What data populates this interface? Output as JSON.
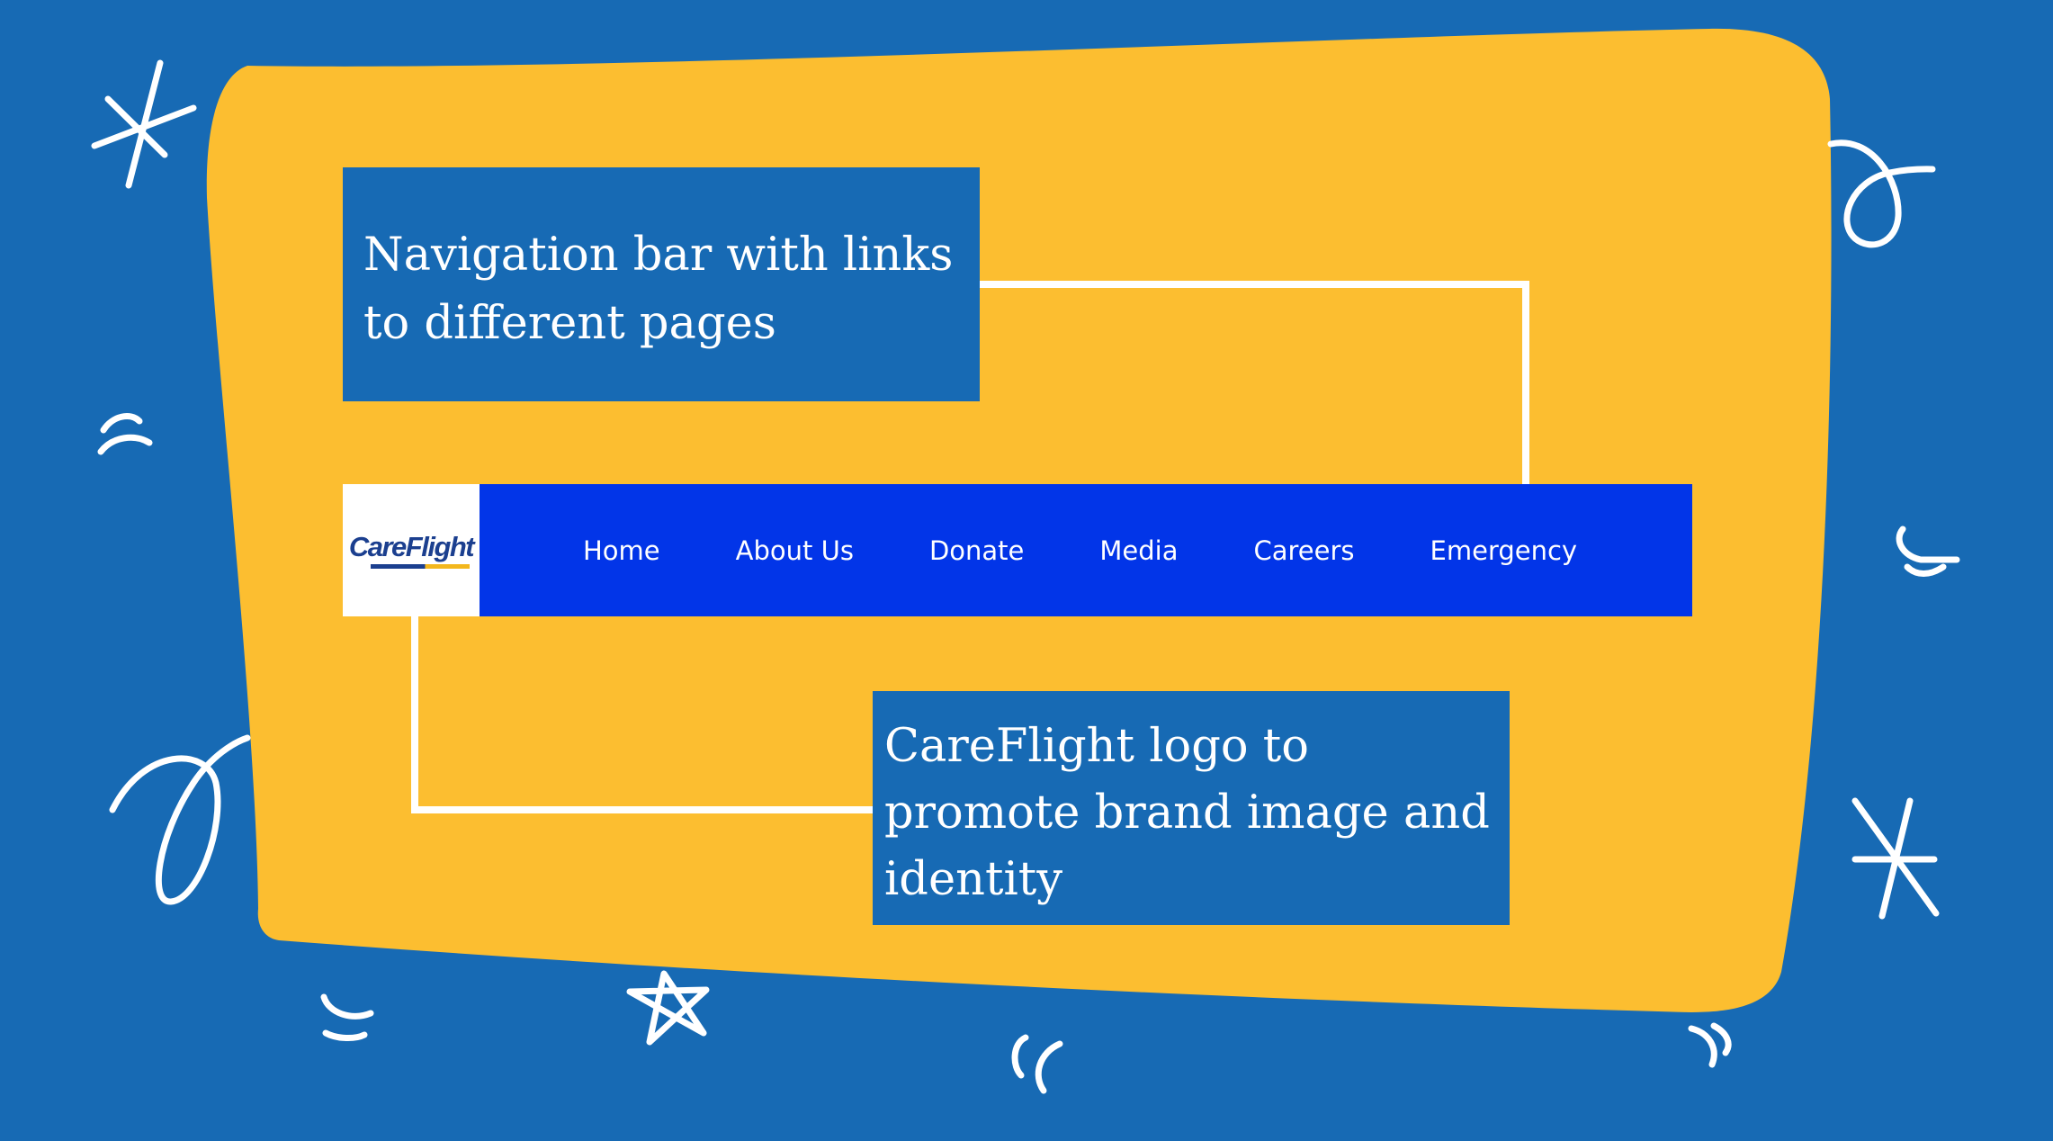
{
  "colors": {
    "background": "#176ab4",
    "blob": "#fcbe30",
    "callout_bg": "#176ab4",
    "navbar_bg": "#0235e8",
    "connector": "#ffffff",
    "doodle": "#ffffff",
    "logo_blue": "#1b3f8f",
    "logo_accent": "#f3b71d"
  },
  "callouts": {
    "nav": {
      "text": "Navigation bar with links to different pages"
    },
    "logo": {
      "text": "CareFlight logo to promote brand image and identity"
    }
  },
  "navbar": {
    "logo": {
      "text": "CareFlight",
      "icon": "careflight-logo"
    },
    "links": [
      {
        "label": "Home"
      },
      {
        "label": "About Us"
      },
      {
        "label": "Donate"
      },
      {
        "label": "Media"
      },
      {
        "label": "Careers"
      },
      {
        "label": "Emergency"
      }
    ]
  },
  "decorations": {
    "icons": [
      "asterisk-doodle",
      "loop-doodle",
      "star-doodle",
      "quote-mark-doodle",
      "bracket-doodle"
    ]
  }
}
